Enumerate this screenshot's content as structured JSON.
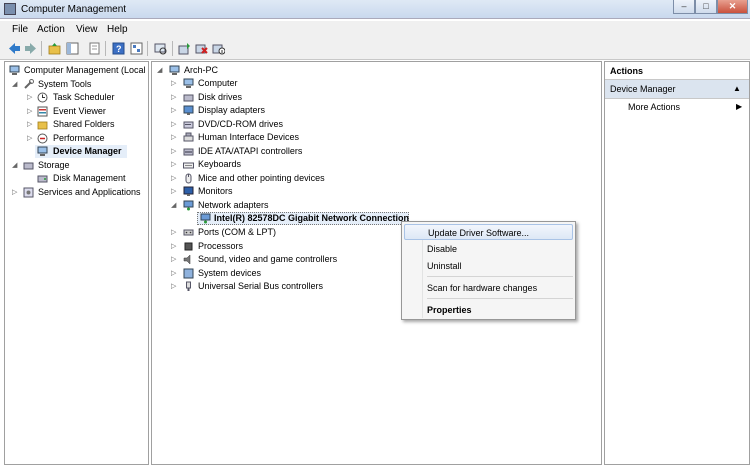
{
  "window": {
    "title": "Computer Management"
  },
  "menu": [
    "File",
    "Action",
    "View",
    "Help"
  ],
  "left_tree": {
    "root": "Computer Management (Local",
    "system_tools": "System Tools",
    "task_scheduler": "Task Scheduler",
    "event_viewer": "Event Viewer",
    "shared_folders": "Shared Folders",
    "performance": "Performance",
    "device_manager": "Device Manager",
    "storage": "Storage",
    "disk_management": "Disk Management",
    "services": "Services and Applications"
  },
  "device_tree": {
    "root": "Arch-PC",
    "categories": [
      "Computer",
      "Disk drives",
      "Display adapters",
      "DVD/CD-ROM drives",
      "Human Interface Devices",
      "IDE ATA/ATAPI controllers",
      "Keyboards",
      "Mice and other pointing devices",
      "Monitors",
      "Network adapters"
    ],
    "network_child": "Intel(R) 82578DC Gigabit Network Connection",
    "categories_after": [
      "Ports (COM & LPT)",
      "Processors",
      "Sound, video and game controllers",
      "System devices",
      "Universal Serial Bus controllers"
    ]
  },
  "context_menu": {
    "update": "Update Driver Software...",
    "disable": "Disable",
    "uninstall": "Uninstall",
    "scan": "Scan for hardware changes",
    "properties": "Properties"
  },
  "actions": {
    "header": "Actions",
    "section": "Device Manager",
    "more": "More Actions"
  },
  "colors": {
    "accent": "#3a6ea5",
    "selection": "#e5eef9"
  }
}
